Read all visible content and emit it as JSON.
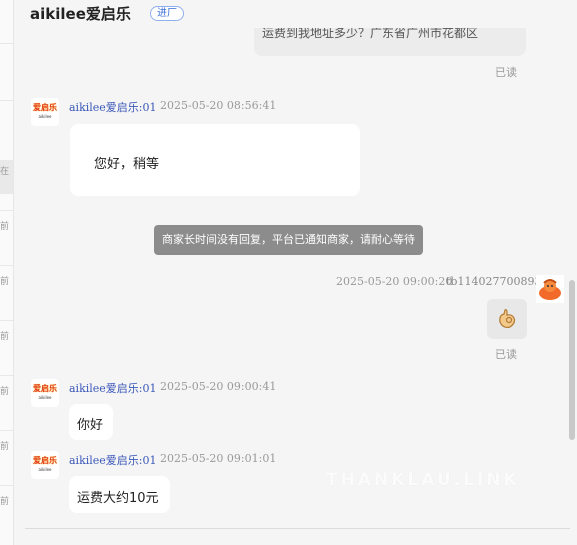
{
  "header": {
    "title": "aikilee爱启乐",
    "badge": "进厂"
  },
  "left_strip": {
    "items": [
      "在",
      "前",
      "前",
      "前",
      "前",
      "前",
      "前"
    ]
  },
  "top_cut_message": {
    "text": "运费到我地址多少？广东省广州市花都区",
    "read_status": "已读"
  },
  "messages": [
    {
      "sender": "aikilee爱启乐:01",
      "time": "2025-05-20 08:56:41",
      "text": "您好，稍等"
    },
    {
      "system": "商家长时间没有回复，平台已通知商家，请耐心等待"
    },
    {
      "sender": "tb114027700893",
      "time": "2025-05-20 09:00:20",
      "read_status": "已读"
    },
    {
      "sender": "aikilee爱启乐:01",
      "time": "2025-05-20 09:00:41",
      "text": "你好"
    },
    {
      "sender": "aikilee爱启乐:01",
      "time": "2025-05-20 09:01:01",
      "text": "运费大约10元"
    }
  ],
  "logo": {
    "text": "爱启乐",
    "sub": "aikilee"
  },
  "watermark": "THANKLAU.LINK",
  "colors": {
    "sender_link": "#3a57b8",
    "system_notice_bg": "#8c8c8c",
    "badge_blue": "#3d6fd8"
  }
}
